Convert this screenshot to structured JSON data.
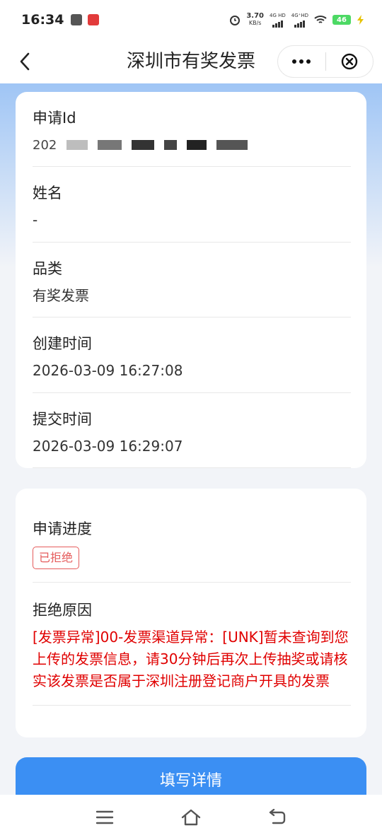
{
  "status_bar": {
    "time": "16:34",
    "net_speed": "3.70",
    "net_unit": "KB/s",
    "sim1": "4G HD",
    "sim2": "4G⁺HD",
    "battery": "46"
  },
  "nav": {
    "title": "深圳市有奖发票",
    "back_icon": "chevron-left-icon",
    "more_icon": "more-dots-icon",
    "close_icon": "close-circle-icon"
  },
  "info_card": {
    "fields": [
      {
        "label": "申请Id",
        "value": "202"
      },
      {
        "label": "姓名",
        "value": "-"
      },
      {
        "label": "品类",
        "value": "有奖发票"
      },
      {
        "label": "创建时间",
        "value": "2026-03-09 16:27:08"
      },
      {
        "label": "提交时间",
        "value": "2026-03-09 16:29:07"
      }
    ]
  },
  "progress_card": {
    "progress_label": "申请进度",
    "status_tag": "已拒绝",
    "reason_label": "拒绝原因",
    "reason_text": "[发票异常]00-发票渠道异常：[UNK]暂未查询到您上传的发票信息，请30分钟后再次上传抽奖或请核实该发票是否属于深圳注册登记商户开具的发票",
    "status_color": "#e55b5b",
    "reason_color": "#e00000"
  },
  "actions": {
    "fill_details": "填写详情",
    "button_color": "#3b8ff3"
  },
  "system_nav": {
    "menu_icon": "menu-icon",
    "home_icon": "home-icon",
    "back_icon": "back-arrow-icon"
  }
}
